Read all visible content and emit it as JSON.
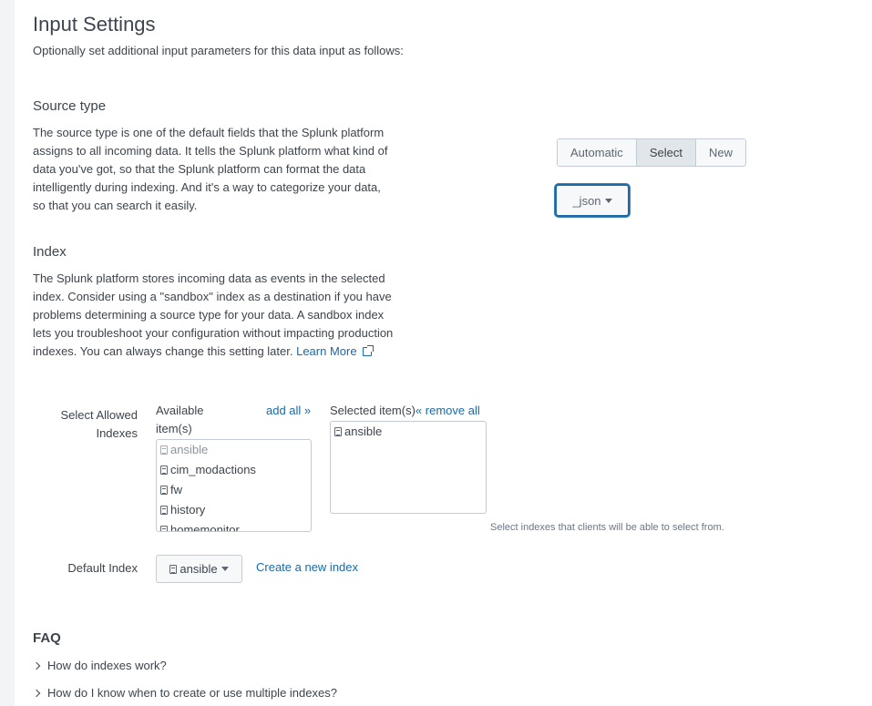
{
  "header": {
    "title": "Input Settings",
    "subtitle": "Optionally set additional input parameters for this data input as follows:"
  },
  "source_type": {
    "title": "Source type",
    "description": "The source type is one of the default fields that the Splunk platform assigns to all incoming data. It tells the Splunk platform what kind of data you've got, so that the Splunk platform can format the data intelligently during indexing. And it's a way to categorize your data, so that you can search it easily.",
    "mode_buttons": [
      {
        "label": "Automatic",
        "active": false
      },
      {
        "label": "Select",
        "active": true
      },
      {
        "label": "New",
        "active": false
      }
    ],
    "selected_value": "_json"
  },
  "index": {
    "title": "Index",
    "description": "The Splunk platform stores incoming data as events in the selected index. Consider using a \"sandbox\" index as a destination if you have problems determining a source type for your data. A sandbox index lets you troubleshoot your configuration without impacting production indexes. You can always change this setting later.",
    "learn_more_label": "Learn More",
    "allowed_indexes": {
      "label": "Select Allowed Indexes",
      "available_header": "Available item(s)",
      "add_all_label": "add all »",
      "selected_header": "Selected item(s)",
      "remove_all_label": "« remove all",
      "available_items": [
        {
          "name": "ansible",
          "disabled": true
        },
        {
          "name": "cim_modactions",
          "disabled": false
        },
        {
          "name": "fw",
          "disabled": false
        },
        {
          "name": "history",
          "disabled": false
        },
        {
          "name": "homemonitor",
          "disabled": false
        }
      ],
      "selected_items": [
        {
          "name": "ansible"
        }
      ],
      "hint": "Select indexes that clients will be able to select from."
    },
    "default_index": {
      "label": "Default Index",
      "value": "ansible",
      "create_link_label": "Create a new index"
    }
  },
  "faq": {
    "title": "FAQ",
    "items": [
      "How do indexes work?",
      "How do I know when to create or use multiple indexes?"
    ]
  },
  "colors": {
    "link": "#1a6aa6",
    "focus_border": "#1e6aa6",
    "text": "#3c444d"
  }
}
